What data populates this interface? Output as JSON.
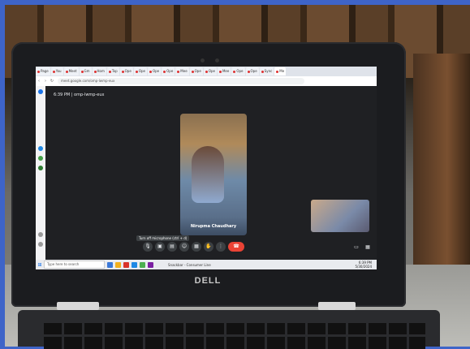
{
  "browser": {
    "tabs": [
      "Page",
      "You",
      "Meet",
      "Gm",
      "Hom",
      "Top",
      "Ope",
      "Ope",
      "Ope",
      "Ope",
      "Mee",
      "Ope",
      "Ope",
      "Mee",
      "Ope",
      "Ope",
      "Sync",
      "Me"
    ],
    "url": "meet.google.com/omp-lwmp-eux"
  },
  "meet": {
    "time": "6:39 PM",
    "separator": "|",
    "code": "omp-lwmp-eux",
    "participant_name": "Nirupma Chaudhary",
    "tooltip": "Turn off microphone (ctrl + d)",
    "controls": [
      "mic-icon",
      "camera-icon",
      "captions-icon",
      "emoji-icon",
      "present-icon",
      "raise-hand-icon",
      "more-icon",
      "end-call-icon"
    ]
  },
  "taskbar": {
    "search_placeholder": "Type here to search",
    "snackbar": "Snackbar - Consumer Line",
    "time": "6:39 PM",
    "date": "5/30/2024"
  },
  "brand": "DELL",
  "colors": {
    "end_call": "#ea4335",
    "meet_bg": "#1f2023",
    "frame": "#3e64c8"
  }
}
